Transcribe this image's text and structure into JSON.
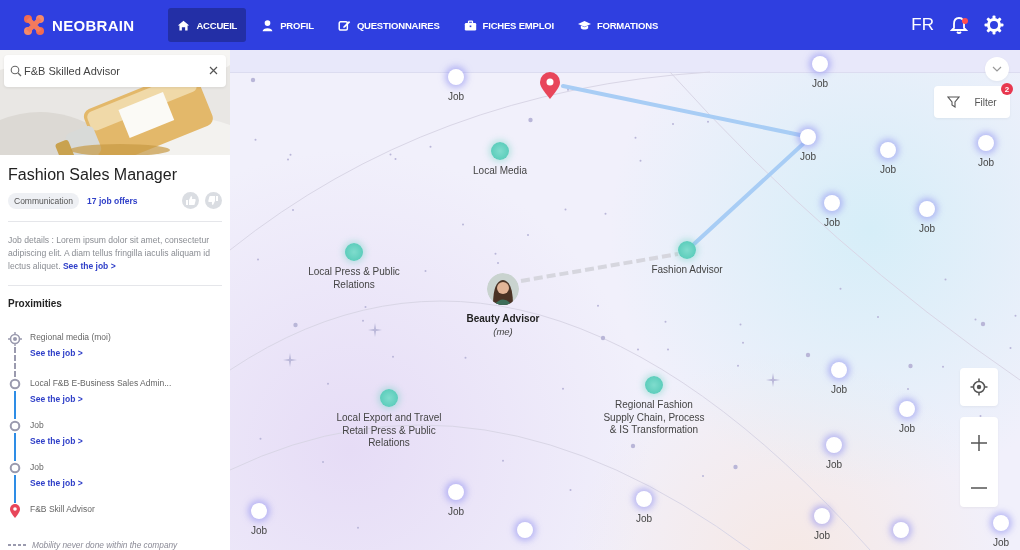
{
  "header": {
    "logo": "NEOBRAIN",
    "nav": [
      {
        "label": "ACCUEIL",
        "selected": true
      },
      {
        "label": "PROFIL",
        "selected": false
      },
      {
        "label": "QUESTIONNAIRES",
        "selected": false
      },
      {
        "label": "FICHES EMPLOI",
        "selected": false
      },
      {
        "label": "FORMATIONS",
        "selected": false
      }
    ],
    "language": "FR",
    "notifications": {
      "unread": true
    }
  },
  "sidebar": {
    "search": {
      "value": "F&B Skilled Advisor"
    },
    "job": {
      "title": "Fashion Sales Manager",
      "tag": "Communication",
      "offers": "17 job offers",
      "details": "Job details : Lorem ipsum dolor sit amet, consectetur adipiscing elit. A diam tellus fringilla iaculis aliquam id lectus aliquet.",
      "details_link": "See the job >"
    },
    "proximities": {
      "title": "Proximities",
      "steps": [
        {
          "kind": "origin",
          "label": "Regional media (moi)",
          "link": "See the job >",
          "mobility_never_done": true
        },
        {
          "kind": "step",
          "label": "Local F&B E-Business Sales Admin...",
          "link": "See the job >",
          "mobility_never_done": false
        },
        {
          "kind": "step",
          "label": "Job",
          "link": "See the job >",
          "mobility_never_done": false
        },
        {
          "kind": "step",
          "label": "Job",
          "link": "See the job >",
          "mobility_never_done": false
        },
        {
          "kind": "target",
          "label": "F&B Skill Advisor"
        }
      ],
      "legend": "Mobility never done within the company"
    }
  },
  "map": {
    "filter": {
      "label": "Filter",
      "badge": "2"
    },
    "me": {
      "title": "Beauty Advisor",
      "subtitle": "(me)"
    },
    "nodes": [
      {
        "kind": "job",
        "label": "Job"
      },
      {
        "kind": "job",
        "label": "Job"
      },
      {
        "kind": "domain",
        "label": "Local Media"
      },
      {
        "kind": "job",
        "label": "Job"
      },
      {
        "kind": "job",
        "label": "Job"
      },
      {
        "kind": "job",
        "label": "Job"
      },
      {
        "kind": "job",
        "label": "Job"
      },
      {
        "kind": "job",
        "label": "Job"
      },
      {
        "kind": "domain",
        "label": "Local Press & Public Relations"
      },
      {
        "kind": "domain",
        "label": "Fashion Advisor"
      },
      {
        "kind": "job",
        "label": "Job"
      },
      {
        "kind": "domain",
        "label": "Local Export and Travel Retail Press & Public Relations"
      },
      {
        "kind": "domain",
        "label": "Regional Fashion Supply Chain, Process & IS Transformation"
      },
      {
        "kind": "job",
        "label": "Job"
      },
      {
        "kind": "job",
        "label": "Job"
      },
      {
        "kind": "job",
        "label": "Job"
      },
      {
        "kind": "job",
        "label": "Job"
      },
      {
        "kind": "job",
        "label": "Job"
      },
      {
        "kind": "job",
        "label": "Job"
      },
      {
        "kind": "job",
        "label": "Job"
      },
      {
        "kind": "job"
      },
      {
        "kind": "job"
      }
    ]
  }
}
